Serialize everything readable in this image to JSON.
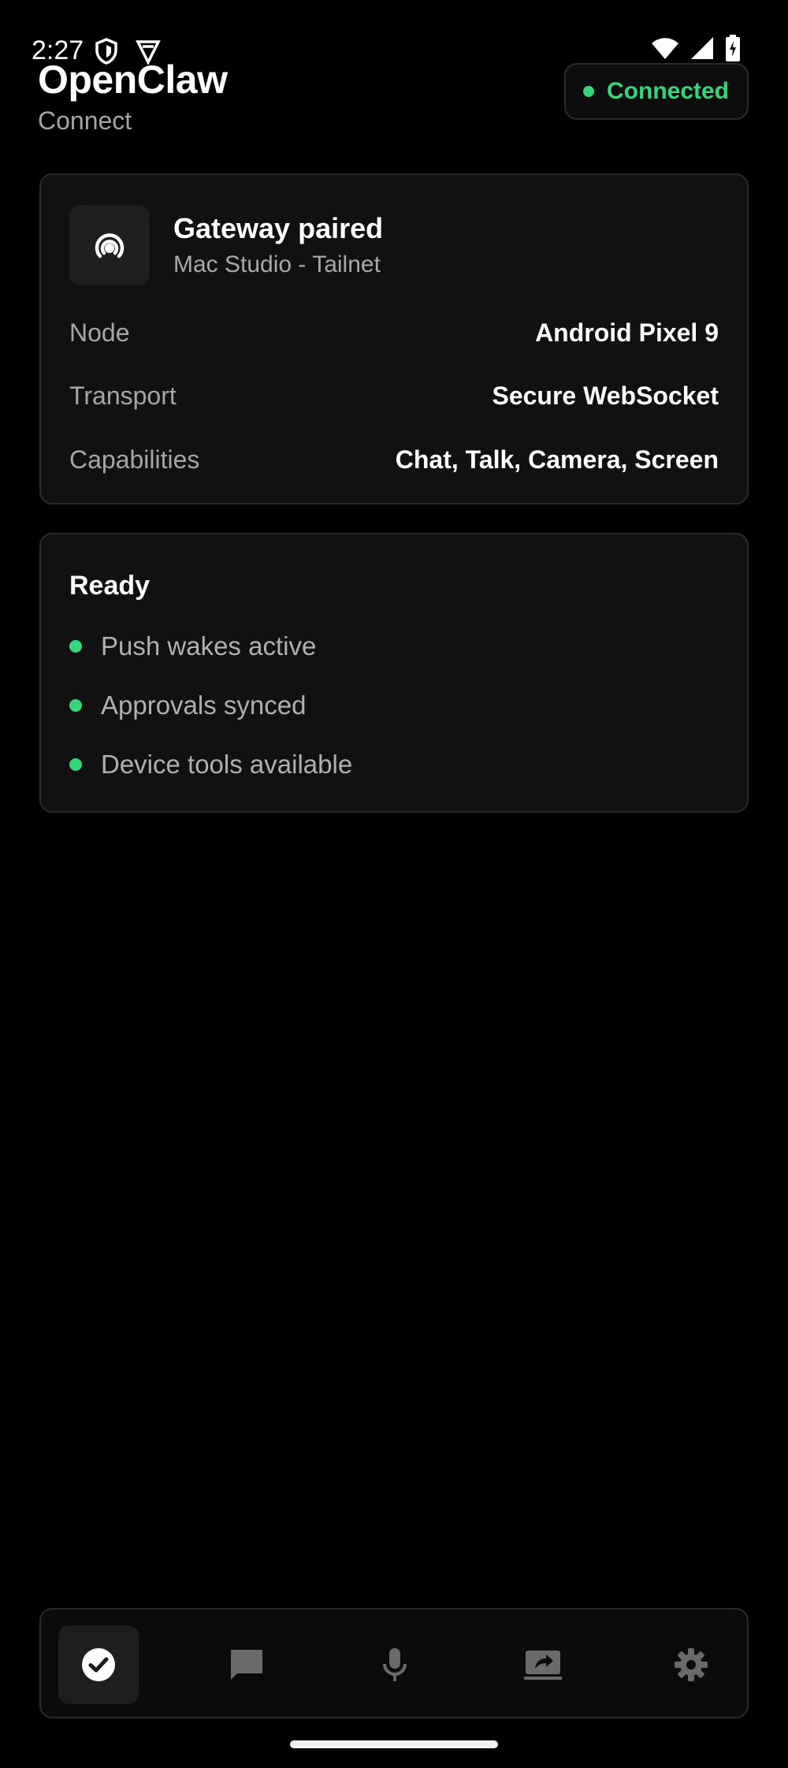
{
  "status_bar": {
    "time": "2:27",
    "icons": [
      "shield-icon",
      "vpn-icon",
      "wifi-icon",
      "cell-signal-icon",
      "battery-charging-icon"
    ]
  },
  "header": {
    "title": "OpenClaw",
    "subtitle": "Connect",
    "connection_status": "Connected",
    "status_color": "#37d67a"
  },
  "gateway_card": {
    "icon": "radio-signal-icon",
    "title": "Gateway paired",
    "subtitle": "Mac Studio - Tailnet",
    "rows": [
      {
        "key": "Node",
        "value": "Android Pixel 9"
      },
      {
        "key": "Transport",
        "value": "Secure WebSocket"
      },
      {
        "key": "Capabilities",
        "value": "Chat, Talk, Camera, Screen"
      }
    ]
  },
  "ready_card": {
    "title": "Ready",
    "items": [
      "Push wakes active",
      "Approvals synced",
      "Device tools available"
    ]
  },
  "bottom_nav": {
    "items": [
      {
        "icon": "check-circle-icon",
        "active": true
      },
      {
        "icon": "chat-icon",
        "active": false
      },
      {
        "icon": "microphone-icon",
        "active": false
      },
      {
        "icon": "screen-share-icon",
        "active": false
      },
      {
        "icon": "gear-icon",
        "active": false
      }
    ]
  }
}
